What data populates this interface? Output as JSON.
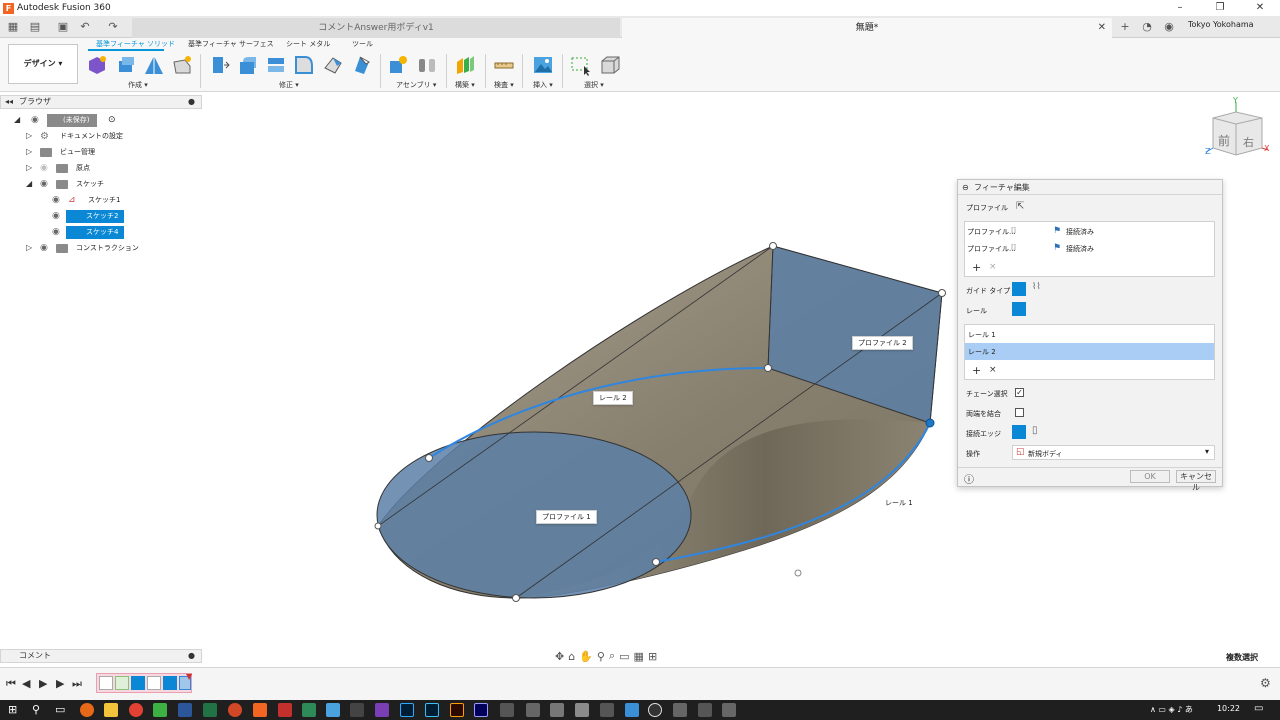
{
  "app": {
    "title": "Autodesk Fusion 360",
    "icon": "F"
  },
  "tabs": [
    {
      "label": "コメントAnswer用ボディv1"
    },
    {
      "label": "無題*"
    }
  ],
  "user": "Tokyo Yokohama",
  "ribbon": {
    "workspace": "デザイン ▾",
    "tabs": [
      "基準フィーチャ ソリッド",
      "基準フィーチャ サーフェス",
      "シート メタル",
      "ツール"
    ],
    "groups": [
      "作成 ▾",
      "修正 ▾",
      "アセンブリ ▾",
      "構築 ▾",
      "検査 ▾",
      "挿入 ▾",
      "選択 ▾"
    ]
  },
  "browser": {
    "title": "ブラウザ",
    "items": [
      {
        "label": "(未保存)"
      },
      {
        "label": "ドキュメントの設定"
      },
      {
        "label": "ビュー管理"
      },
      {
        "label": "原点"
      },
      {
        "label": "スケッチ"
      },
      {
        "label": "スケッチ1"
      },
      {
        "label": "スケッチ2"
      },
      {
        "label": "スケッチ4"
      },
      {
        "label": "コンストラクション"
      }
    ]
  },
  "viewcube": {
    "front": "前",
    "right": "右",
    "axis_y": "Y",
    "axis_z": "Z",
    "axis_x": "X"
  },
  "viewport": {
    "callouts": {
      "profile1": "プロファイル 1",
      "profile2": "プロファイル 2",
      "rail1": "レール 1",
      "rail2": "レール 2"
    }
  },
  "dialog": {
    "title": "フィーチャ編集",
    "profile_label": "プロファイル",
    "profile_rows": [
      {
        "name": "プロファイル...",
        "status": "接続済み"
      },
      {
        "name": "プロファイル...",
        "status": "接続済み"
      }
    ],
    "guide_type_label": "ガイド タイプ",
    "rail_label": "レール",
    "rails": [
      "レール 1",
      "レール 2"
    ],
    "chain_label": "チェーン選択",
    "chain_symbol": "✓",
    "merge_label": "両端を結合",
    "tangent_label": "接続エッジ",
    "operation_label": "操作",
    "operation_value": "新規ボディ",
    "ok": "OK",
    "cancel": "キャンセル",
    "add_symbol": "+",
    "remove_symbol": "×"
  },
  "comments": {
    "title": "コメント"
  },
  "multi_select": "複数選択",
  "clock": "10:22"
}
